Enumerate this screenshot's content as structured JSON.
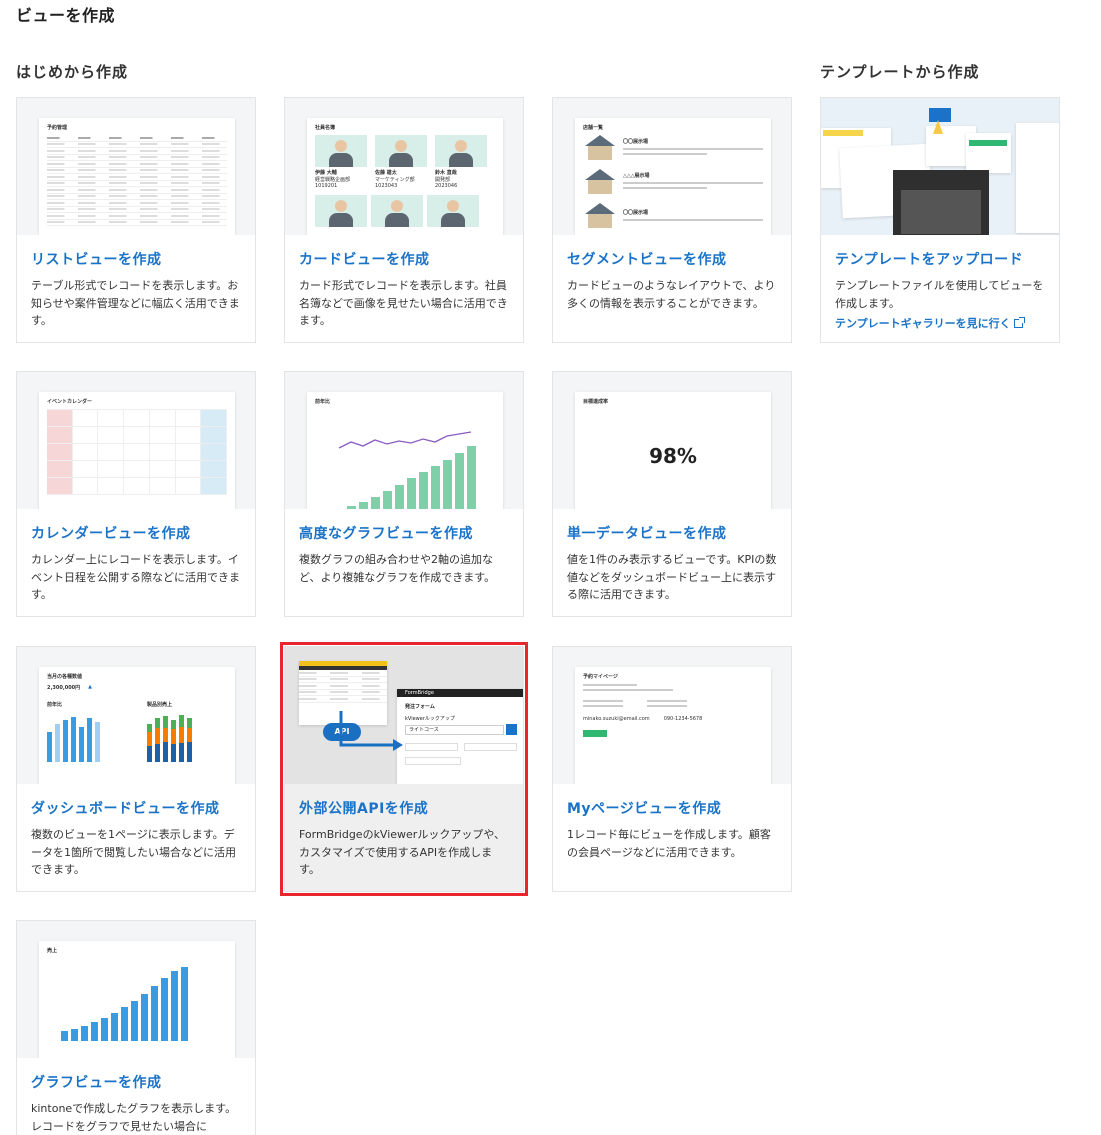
{
  "page": {
    "title": "ビューを作成"
  },
  "sections": {
    "scratch": "はじめから作成",
    "template": "テンプレートから作成"
  },
  "cards": {
    "list": {
      "title": "リストビューを作成",
      "desc": "テーブル形式でレコードを表示します。お知らせや案件管理などに幅広く活用できます。",
      "thumb_heading": "予約管理"
    },
    "card": {
      "title": "カードビューを作成",
      "desc": "カード形式でレコードを表示します。社員名簿などで画像を見せたい場合に活用できます。",
      "thumb_heading": "社員名簿",
      "people": [
        {
          "name": "伊藤 大輔",
          "dept": "経営戦略企画部",
          "id": "1019201"
        },
        {
          "name": "佐藤 雄太",
          "dept": "マーケティング部",
          "id": "1023043"
        },
        {
          "name": "鈴木 直哉",
          "dept": "開発部",
          "id": "2023046"
        }
      ]
    },
    "segment": {
      "title": "セグメントビューを作成",
      "desc": "カードビューのようなレイアウトで、より多くの情報を表示することができます。",
      "thumb_heading": "店舗一覧",
      "stores": [
        "〇〇展示場",
        "△△△展示場",
        "〇〇展示場"
      ]
    },
    "template": {
      "title": "テンプレートをアップロード",
      "desc": "テンプレートファイルを使用してビューを作成します。",
      "link": "テンプレートギャラリーを見に行く"
    },
    "calendar": {
      "title": "カレンダービューを作成",
      "desc": "カレンダー上にレコードを表示します。イベント日程を公開する際などに活用できます。",
      "thumb_heading": "イベントカレンダー"
    },
    "advanced_graph": {
      "title": "高度なグラフビューを作成",
      "desc": "複数グラフの組み合わせや2軸の追加など、より複雑なグラフを作成できます。",
      "thumb_heading": "前年比"
    },
    "single_data": {
      "title": "単一データビューを作成",
      "desc": "値を1件のみ表示するビューです。KPIの数値などをダッシュボードビュー上に表示する際に活用できます。",
      "thumb_heading": "目標達成率",
      "value": "98%"
    },
    "dashboard": {
      "title": "ダッシュボードビューを作成",
      "desc": "複数のビューを1ページに表示します。データを1箇所で閲覧したい場合などに活用できます。",
      "thumb_heading": "当月の各種数値",
      "sub1": "前年比",
      "sub2": "製品別売上",
      "kpi": "2,300,000円"
    },
    "api": {
      "title": "外部公開APIを作成",
      "desc": "FormBridgeのkViewerルックアップや、カスタマイズで使用するAPIを作成します。",
      "api_badge": "API",
      "form_brand": "FormBridge",
      "form_title": "発注フォーム",
      "lookup_label": "kViewerルックアップ",
      "lookup_value": "ライトコース"
    },
    "mypage": {
      "title": "Myページビューを作成",
      "desc": "1レコード毎にビューを作成します。顧客の会員ページなどに活用できます。",
      "thumb_heading": "予約マイページ",
      "email": "minako.suzuki@email.com",
      "phone": "090-1234-5678"
    },
    "graph": {
      "title": "グラフビューを作成",
      "desc": "kintoneで作成したグラフを表示します。レコードをグラフで見せたい場合に",
      "thumb_heading": "売上"
    }
  },
  "colors": {
    "link": "#1a73c8",
    "highlight": "#e8262d",
    "accent_green": "#7fd0a8",
    "accent_blue": "#3a9be0"
  }
}
